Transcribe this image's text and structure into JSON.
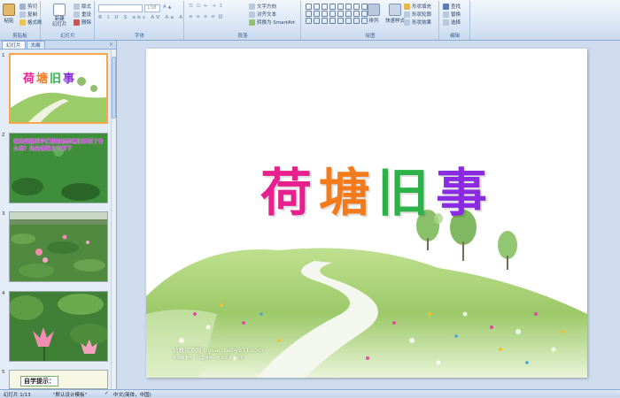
{
  "ribbon": {
    "clipboard": {
      "paste": "粘贴",
      "cut": "剪切",
      "copy": "复制",
      "format_painter": "格式刷",
      "label": "剪贴板"
    },
    "slides": {
      "new_slide": "新建\n幻灯片",
      "layout": "版式",
      "reset": "重设",
      "delete": "删除",
      "label": "幻灯片"
    },
    "font": {
      "size": "138",
      "label": "字体"
    },
    "paragraph": {
      "text_direction": "文字方向",
      "align_text": "对齐文本",
      "smartart": "转换为 SmartArt",
      "label": "段落"
    },
    "drawing": {
      "arrange": "排列",
      "quick_styles": "快速样式",
      "shape_fill": "形状填充",
      "shape_outline": "形状轮廓",
      "shape_effects": "形状效果",
      "label": "绘图"
    },
    "editing": {
      "find": "查找",
      "replace": "替换",
      "select": "选择",
      "label": "编辑"
    }
  },
  "panel": {
    "tabs": [
      "幻灯片",
      "大纲"
    ],
    "close": "×",
    "thumbs": [
      {
        "num": "1",
        "title": "荷塘旧事"
      },
      {
        "num": "2",
        "text": "读完课题同学们想知道荷塘旧事说了什么呢？先来读课文了解下"
      },
      {
        "num": "3"
      },
      {
        "num": "4"
      },
      {
        "num": "5",
        "text": "自学提示："
      }
    ]
  },
  "slide": {
    "title_chars": [
      "荷",
      "塘",
      "旧",
      "事"
    ],
    "title_colors": [
      "#e8208d",
      "#f47b1c",
      "#2db24a",
      "#8a2be2"
    ],
    "watermark": "幼教资源网 ziyuan.baby611.com",
    "watermark_small": "为幼教服务 · 教案课件 · 教育资源 · 试卷"
  },
  "status": {
    "slide": "幻灯片 1/13",
    "theme": "\"默认设计模板\"",
    "lang": "中文(简体，中国)"
  }
}
